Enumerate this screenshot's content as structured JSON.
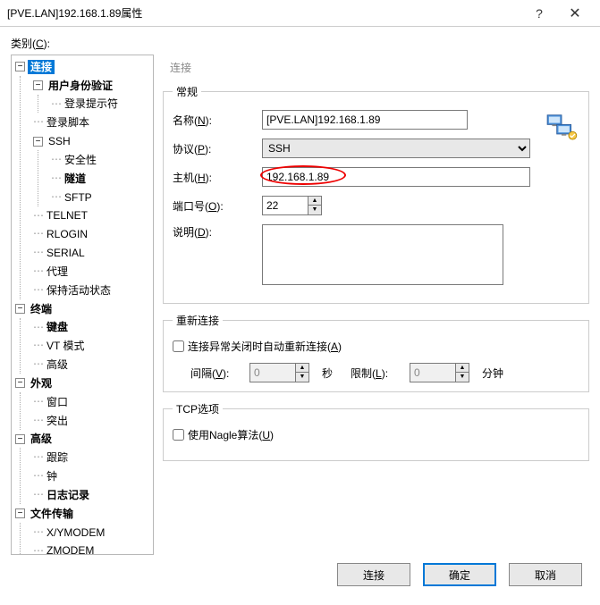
{
  "titlebar": {
    "title": "[PVE.LAN]192.168.1.89属性"
  },
  "category_label": "类别(C):",
  "tree": {
    "root": "连接",
    "auth": "用户身份验证",
    "login_prompt": "登录提示符",
    "login_script": "登录脚本",
    "ssh": "SSH",
    "security": "安全性",
    "tunnel": "隧道",
    "sftp": "SFTP",
    "telnet": "TELNET",
    "rlogin": "RLOGIN",
    "serial": "SERIAL",
    "proxy": "代理",
    "keepalive": "保持活动状态",
    "terminal": "终端",
    "keyboard": "键盘",
    "vt_mode": "VT 模式",
    "advanced1": "高级",
    "appearance": "外观",
    "window": "窗口",
    "highlight": "突出",
    "advanced2": "高级",
    "trace": "跟踪",
    "bell": "钟",
    "logging": "日志记录",
    "file_transfer": "文件传输",
    "xymodem": "X/YMODEM",
    "zmodem": "ZMODEM"
  },
  "panel_header": "连接",
  "general": {
    "legend": "常规",
    "name_label": "名称(N):",
    "name_value": "[PVE.LAN]192.168.1.89",
    "protocol_label": "协议(P):",
    "protocol_value": "SSH",
    "host_label": "主机(H):",
    "host_value": "192.168.1.89",
    "port_label": "端口号(O):",
    "port_value": "22",
    "desc_label": "说明(D):",
    "desc_value": ""
  },
  "reconnect": {
    "legend": "重新连接",
    "checkbox_label": "连接异常关闭时自动重新连接(A)",
    "interval_label": "间隔(V):",
    "interval_value": "0",
    "interval_unit": "秒",
    "limit_label": "限制(L):",
    "limit_value": "0",
    "limit_unit": "分钟"
  },
  "tcp": {
    "legend": "TCP选项",
    "nagle_label": "使用Nagle算法(U)"
  },
  "footer": {
    "connect": "连接",
    "ok": "确定",
    "cancel": "取消"
  }
}
